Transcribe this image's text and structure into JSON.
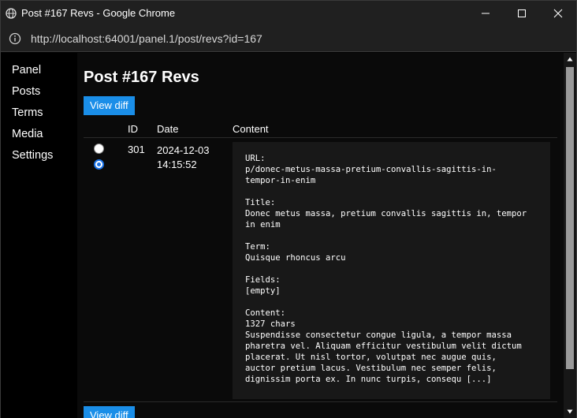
{
  "window": {
    "title": "Post #167 Revs - Google Chrome"
  },
  "browser": {
    "url": "http://localhost:64001/panel.1/post/revs?id=167"
  },
  "sidebar": {
    "items": [
      {
        "label": "Panel"
      },
      {
        "label": "Posts"
      },
      {
        "label": "Terms"
      },
      {
        "label": "Media"
      },
      {
        "label": "Settings"
      }
    ]
  },
  "main": {
    "title": "Post #167 Revs",
    "view_diff_label": "View diff",
    "table": {
      "headers": {
        "id": "ID",
        "date": "Date",
        "content": "Content"
      },
      "rows": [
        {
          "id": "301",
          "date": "2024-12-03 14:15:52",
          "content": "URL:\np/donec-metus-massa-pretium-convallis-sagittis-in-\ntempor-in-enim\n\nTitle:\nDonec metus massa, pretium convallis sagittis in, tempor\nin enim\n\nTerm:\nQuisque rhoncus arcu\n\nFields:\n[empty]\n\nContent:\n1327 chars\nSuspendisse consectetur congue ligula, a tempor massa\npharetra vel. Aliquam efficitur vestibulum velit dictum\nplacerat. Ut nisl tortor, volutpat nec augue quis,\nauctor pretium lacus. Vestibulum nec semper felis,\ndignissim porta ex. In nunc turpis, consequ [...]"
        }
      ]
    }
  },
  "colors": {
    "accent": "#1a8ee8",
    "chrome_bg": "#202020",
    "page_bg": "#000000"
  }
}
